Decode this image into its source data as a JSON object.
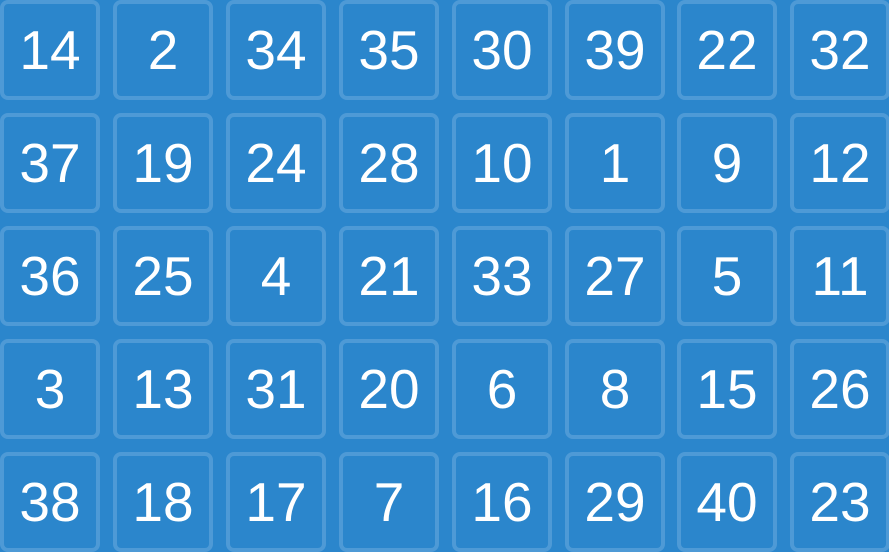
{
  "board": {
    "tiles": [
      "14",
      "2",
      "34",
      "35",
      "30",
      "39",
      "22",
      "32",
      "37",
      "19",
      "24",
      "28",
      "10",
      "1",
      "9",
      "12",
      "36",
      "25",
      "4",
      "21",
      "33",
      "27",
      "5",
      "11",
      "3",
      "13",
      "31",
      "20",
      "6",
      "8",
      "15",
      "26",
      "38",
      "18",
      "17",
      "7",
      "16",
      "29",
      "40",
      "23"
    ]
  }
}
